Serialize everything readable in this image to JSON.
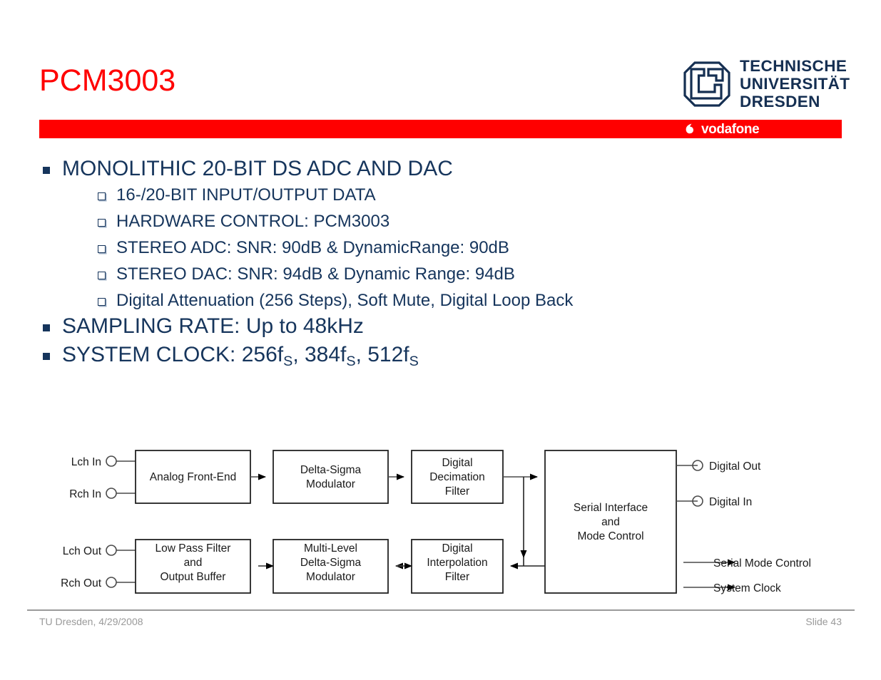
{
  "slide": {
    "title": "PCM3003",
    "accent_red": "#ff0000",
    "navy": "#16355c",
    "footer_gray": "#9a9a9a"
  },
  "branding": {
    "university_line1": "TECHNISCHE",
    "university_line2": "UNIVERSITÄT",
    "university_line3": "DRESDEN",
    "partner": "vodafone"
  },
  "content": {
    "bullets": [
      {
        "level": 1,
        "text": "MONOLITHIC 20-BIT DS ADC AND DAC"
      },
      {
        "level": 2,
        "text": "16-/20-BIT INPUT/OUTPUT DATA"
      },
      {
        "level": 2,
        "text": "HARDWARE CONTROL: PCM3003"
      },
      {
        "level": 2,
        "text": "STEREO ADC:    SNR: 90dB & DynamicRange: 90dB"
      },
      {
        "level": 2,
        "text": "STEREO DAC:    SNR: 94dB & Dynamic Range: 94dB"
      },
      {
        "level": 2,
        "text": "Digital Attenuation (256 Steps), Soft Mute, Digital Loop Back"
      },
      {
        "level": 1,
        "text": "SAMPLING RATE: Up to 48kHz"
      },
      {
        "level": 1,
        "text": "SYSTEM CLOCK: 256fS, 384fS, 512fS"
      }
    ],
    "system_clock": {
      "prefix": "SYSTEM CLOCK: ",
      "v1": "256f",
      "v1sub": "S",
      "sep1": ", ",
      "v2": "384f",
      "v2sub": "S",
      "sep2": ", ",
      "v3": "512f",
      "v3sub": "S"
    }
  },
  "diagram": {
    "blocks": {
      "analog_front_end": "Analog Front-End",
      "delta_sigma_modulator_l1": "Delta-Sigma",
      "delta_sigma_modulator_l2": "Modulator",
      "digital_decimation_l1": "Digital",
      "digital_decimation_l2": "Decimation",
      "digital_decimation_l3": "Filter",
      "serial_interface_l1": "Serial Interface",
      "serial_interface_l2": "and",
      "serial_interface_l3": "Mode Control",
      "low_pass_l1": "Low Pass Filter",
      "low_pass_l2": "and",
      "low_pass_l3": "Output Buffer",
      "multilevel_l1": "Multi-Level",
      "multilevel_l2": "Delta-Sigma",
      "multilevel_l3": "Modulator",
      "interpolation_l1": "Digital",
      "interpolation_l2": "Interpolation",
      "interpolation_l3": "Filter"
    },
    "ports": {
      "lch_in": "Lch In",
      "rch_in": "Rch In",
      "lch_out": "Lch Out",
      "rch_out": "Rch Out",
      "digital_out": "Digital Out",
      "digital_in": "Digital In",
      "serial_mode_control": "Serial Mode Control",
      "system_clock": "System Clock"
    }
  },
  "footer": {
    "left": "TU Dresden, 4/29/2008",
    "right": "Slide 43"
  }
}
